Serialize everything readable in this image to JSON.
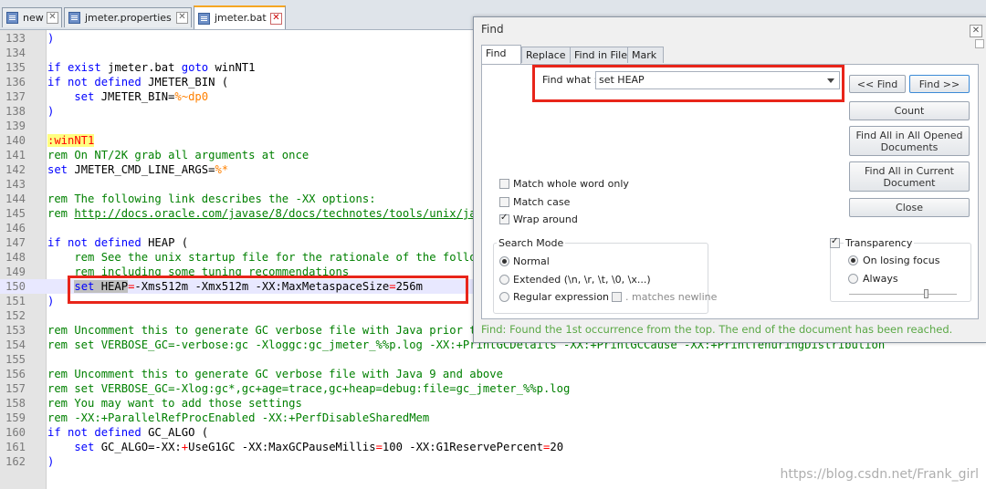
{
  "tabs": [
    {
      "label": "new 1"
    },
    {
      "label": "jmeter.properties"
    },
    {
      "label": "jmeter.bat",
      "active": true
    }
  ],
  "lines": [
    {
      "n": "133",
      "segs": [
        {
          "t": ")",
          "c": "kw"
        }
      ]
    },
    {
      "n": "134",
      "segs": []
    },
    {
      "n": "135",
      "segs": [
        {
          "t": "if exist ",
          "c": "kw"
        },
        {
          "t": "jmeter.bat ",
          "c": "plain"
        },
        {
          "t": "goto ",
          "c": "kw"
        },
        {
          "t": "winNT1",
          "c": "plain"
        }
      ]
    },
    {
      "n": "136",
      "segs": [
        {
          "t": "if not defined ",
          "c": "kw"
        },
        {
          "t": "JMETER_BIN (",
          "c": "plain"
        }
      ]
    },
    {
      "n": "137",
      "segs": [
        {
          "t": "    set ",
          "c": "kw"
        },
        {
          "t": "JMETER_BIN=",
          "c": "plain"
        },
        {
          "t": "%~dp0",
          "c": "var"
        }
      ]
    },
    {
      "n": "138",
      "segs": [
        {
          "t": ")",
          "c": "kw"
        }
      ]
    },
    {
      "n": "139",
      "segs": []
    },
    {
      "n": "140",
      "segs": [
        {
          "t": ":winNT1",
          "c": "lbl"
        }
      ]
    },
    {
      "n": "141",
      "segs": [
        {
          "t": "rem On NT/2K grab all arguments at once",
          "c": "cm"
        }
      ]
    },
    {
      "n": "142",
      "segs": [
        {
          "t": "set ",
          "c": "kw"
        },
        {
          "t": "JMETER_CMD_LINE_ARGS=",
          "c": "plain"
        },
        {
          "t": "%*",
          "c": "var"
        }
      ]
    },
    {
      "n": "143",
      "segs": []
    },
    {
      "n": "144",
      "segs": [
        {
          "t": "rem The following link describes the -XX options:",
          "c": "cm"
        }
      ]
    },
    {
      "n": "145",
      "segs": [
        {
          "t": "rem ",
          "c": "cm"
        },
        {
          "t": "http://docs.oracle.com/javase/8/docs/technotes/tools/unix/java.html",
          "c": "url"
        }
      ]
    },
    {
      "n": "146",
      "segs": []
    },
    {
      "n": "147",
      "segs": [
        {
          "t": "if not defined ",
          "c": "kw"
        },
        {
          "t": "HEAP (",
          "c": "plain"
        }
      ]
    },
    {
      "n": "148",
      "segs": [
        {
          "t": "    rem See the unix startup file for the rationale of the following parameters,",
          "c": "cm"
        }
      ]
    },
    {
      "n": "149",
      "segs": [
        {
          "t": "    rem including some tuning recommendations",
          "c": "cm"
        }
      ]
    },
    {
      "n": "150",
      "current": true,
      "segs": [
        {
          "t": "    ",
          "c": "plain"
        },
        {
          "t": "set HEAP",
          "c": "sel",
          "sub": [
            {
              "t": "set ",
              "c": "kw"
            },
            {
              "t": "HEAP",
              "c": "plain"
            }
          ]
        },
        {
          "t": "=",
          "c": "op"
        },
        {
          "t": "-Xms512m -Xmx512m -XX:MaxMetaspaceSize",
          "c": "plain"
        },
        {
          "t": "=",
          "c": "op"
        },
        {
          "t": "256m",
          "c": "plain"
        }
      ]
    },
    {
      "n": "151",
      "segs": [
        {
          "t": ")",
          "c": "kw"
        }
      ]
    },
    {
      "n": "152",
      "segs": []
    },
    {
      "n": "153",
      "segs": [
        {
          "t": "rem Uncomment this to generate GC verbose file with Java prior to 9",
          "c": "cm"
        }
      ]
    },
    {
      "n": "154",
      "segs": [
        {
          "t": "rem set VERBOSE_GC=-verbose:gc -Xloggc:gc_jmeter_%%p.log -XX:+PrintGCDetails -XX:+PrintGCCause -XX:+PrintTenuringDistribution",
          "c": "cm"
        }
      ]
    },
    {
      "n": "155",
      "segs": []
    },
    {
      "n": "156",
      "segs": [
        {
          "t": "rem Uncomment this to generate GC verbose file with Java 9 and above",
          "c": "cm"
        }
      ]
    },
    {
      "n": "157",
      "segs": [
        {
          "t": "rem set VERBOSE_GC=-Xlog:gc*,gc+age=trace,gc+heap=debug:file=gc_jmeter_%%p.log",
          "c": "cm"
        }
      ]
    },
    {
      "n": "158",
      "segs": [
        {
          "t": "rem You may want to add those settings",
          "c": "cm"
        }
      ]
    },
    {
      "n": "159",
      "segs": [
        {
          "t": "rem -XX:+ParallelRefProcEnabled -XX:+PerfDisableSharedMem",
          "c": "cm"
        }
      ]
    },
    {
      "n": "160",
      "segs": [
        {
          "t": "if not defined ",
          "c": "kw"
        },
        {
          "t": "GC_ALGO (",
          "c": "plain"
        }
      ]
    },
    {
      "n": "161",
      "segs": [
        {
          "t": "    set ",
          "c": "kw"
        },
        {
          "t": "GC_ALGO=",
          "c": "plain"
        },
        {
          "t": "-XX:",
          "c": "plain"
        },
        {
          "t": "+",
          "c": "op"
        },
        {
          "t": "UseG1GC -XX:MaxGCPauseMillis",
          "c": "plain"
        },
        {
          "t": "=",
          "c": "op"
        },
        {
          "t": "100 -XX:G1ReservePercent",
          "c": "plain"
        },
        {
          "t": "=",
          "c": "op"
        },
        {
          "t": "20",
          "c": "plain"
        }
      ]
    },
    {
      "n": "162",
      "segs": [
        {
          "t": ")",
          "c": "kw"
        }
      ]
    }
  ],
  "find_dialog": {
    "title": "Find",
    "tabs": [
      "Find",
      "Replace",
      "Find in Files",
      "Mark"
    ],
    "find_what_label": "Find what :",
    "find_what_value": "set HEAP",
    "buttons": {
      "prev": "<< Find",
      "next": "Find >>",
      "count": "Count",
      "find_all_opened": "Find All in All Opened Documents",
      "find_all_current": "Find All in Current Document",
      "close": "Close"
    },
    "options": {
      "match_whole_word": "Match whole word only",
      "match_case": "Match case",
      "wrap_around": "Wrap around"
    },
    "search_mode": {
      "title": "Search Mode",
      "normal": "Normal",
      "extended": "Extended (\\n, \\r, \\t, \\0, \\x...)",
      "regex": "Regular expression",
      "matches_newline": ". matches newline"
    },
    "transparency": {
      "title": "Transparency",
      "on_losing_focus": "On losing focus",
      "always": "Always"
    },
    "status": "Find: Found the 1st occurrence from the top. The end of the document has been reached."
  },
  "watermark": "https://blog.csdn.net/Frank_girl"
}
